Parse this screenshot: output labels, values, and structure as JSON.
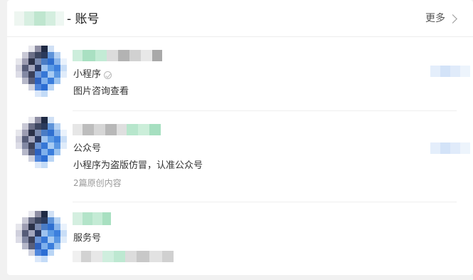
{
  "header": {
    "title_suffix": "- 账号",
    "more_label": "更多"
  },
  "results": [
    {
      "type_label": "小程序",
      "verified": true,
      "description": "图片咨询查看",
      "meta": ""
    },
    {
      "type_label": "公众号",
      "verified": false,
      "description": "小程序为盗版仿冒，认准公众号",
      "meta": "2篇原创内容"
    },
    {
      "type_label": "服务号",
      "verified": false,
      "description": "",
      "meta": ""
    }
  ],
  "icons": {
    "more": "chevron-right-icon",
    "verified": "verified-check-icon"
  },
  "colors": {
    "card_bg": "#ffffff",
    "page_bg": "#f1f1f1",
    "text_primary": "#1a1a1a",
    "text_secondary": "#333333",
    "text_meta": "#999999",
    "blur_green": "#bfe9d2",
    "blur_blue": "#d9e8fb",
    "blur_gray": "#c4c4c4"
  }
}
